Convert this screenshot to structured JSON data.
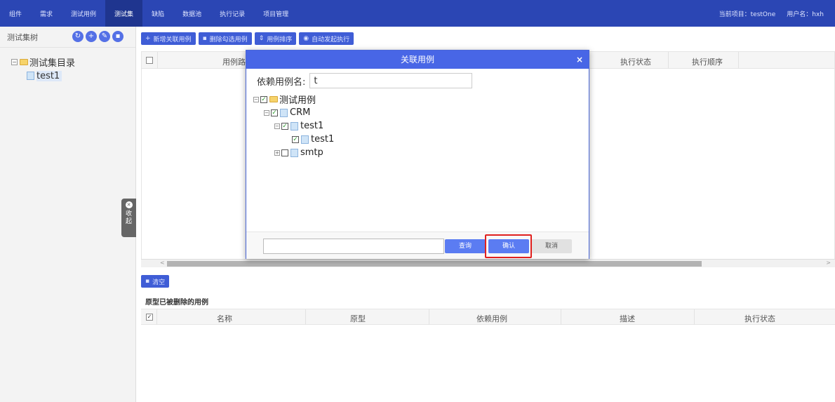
{
  "nav": {
    "items": [
      "组件",
      "需求",
      "测试用例",
      "测试集",
      "缺陷",
      "数据池",
      "执行记录",
      "项目管理"
    ],
    "active_index": 3,
    "current_project": "当前项目：testOne",
    "username": "用户名：hxh"
  },
  "sidebar": {
    "title": "测试集树",
    "tools": [
      "refresh-icon",
      "plus-icon",
      "edit-icon",
      "delete-icon"
    ],
    "root_label": "测试集目录",
    "child_label": "test1",
    "collapse_label": "收起"
  },
  "toolbar": {
    "add_label": "新增关联用例",
    "delete_label": "删除勾选用例",
    "sort_label": "用例排序",
    "run_label": "自动发起执行"
  },
  "grid": {
    "columns": [
      "用例路",
      "执行状态",
      "执行顺序"
    ]
  },
  "lower": {
    "clear_label": "清空",
    "section_title": "原型已被删除的用例",
    "columns": [
      "名称",
      "原型",
      "依赖用例",
      "描述",
      "执行状态"
    ]
  },
  "modal": {
    "title": "关联用例",
    "search_label": "依赖用例名:",
    "search_value": "t",
    "tree": [
      {
        "label": "测试用例",
        "level": 0,
        "checked": true,
        "expander": "-",
        "icon": "folder"
      },
      {
        "label": "CRM",
        "level": 1,
        "checked": true,
        "expander": "-",
        "icon": "file"
      },
      {
        "label": "test1",
        "level": 2,
        "checked": true,
        "expander": "-",
        "icon": "file"
      },
      {
        "label": "test1",
        "level": 3,
        "checked": true,
        "expander": "",
        "icon": "file"
      },
      {
        "label": "smtp",
        "level": 2,
        "checked": false,
        "expander": "+",
        "icon": "file"
      }
    ],
    "query_label": "查询",
    "ok_label": "确认",
    "cancel_label": "取消"
  }
}
